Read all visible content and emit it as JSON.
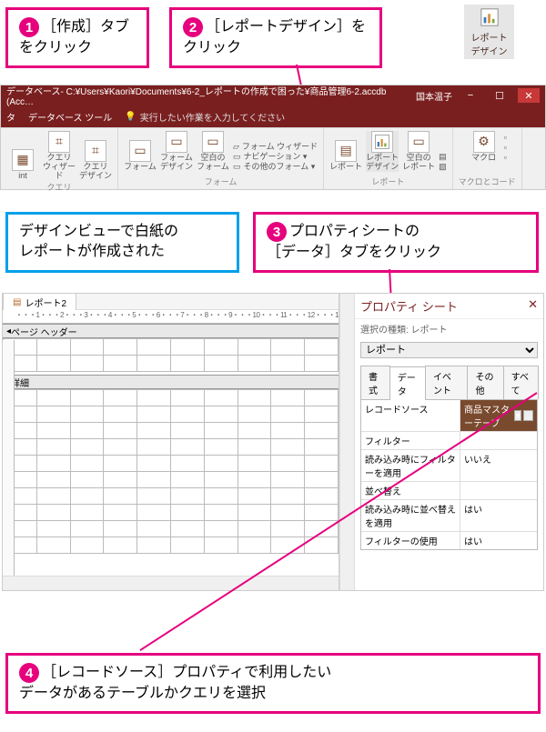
{
  "callouts": {
    "c1": {
      "num": "1",
      "text": "［作成］タブをクリック"
    },
    "c2": {
      "num": "2",
      "text": "［レポートデザイン］をクリック"
    },
    "cBlue": {
      "text1": "デザインビューで白紙の",
      "text2": "レポートが作成された"
    },
    "c3": {
      "num": "3",
      "text1": "プロパティシートの",
      "text2": "［データ］タブをクリック"
    },
    "c4": {
      "num": "4",
      "text1": "［レコードソース］プロパティで利用したい",
      "text2": "データがあるテーブルかクエリを選択"
    }
  },
  "report_icon_label": "レポート\nデザイン",
  "window": {
    "title": "データベース- C:¥Users¥Kaori¥Documents¥6-2_レポートの作成で困った¥商品管理6-2.accdb (Acc…",
    "user": "国本温子",
    "tabs": [
      "タ",
      "データベース ツール"
    ],
    "search_hint": "実行したい作業を入力してください"
  },
  "ribbon": {
    "groups": [
      {
        "label": "クエリ",
        "items": [
          {
            "label": "int"
          },
          {
            "label": "クエリ\nウィザード"
          },
          {
            "label": "クエリ\nデザイン"
          }
        ]
      },
      {
        "label": "フォーム",
        "items": [
          {
            "label": "フォーム"
          },
          {
            "label": "フォーム\nデザイン"
          },
          {
            "label": "空白の\nフォーム"
          }
        ],
        "side": [
          "フォーム ウィザード",
          "ナビゲーション ▾",
          "その他のフォーム ▾"
        ]
      },
      {
        "label": "レポート",
        "items": [
          {
            "label": "レポート"
          },
          {
            "label": "レポート\nデザイン"
          },
          {
            "label": "空白の\nレポート"
          }
        ],
        "side_icons": 2
      },
      {
        "label": "マクロとコード",
        "items": [
          {
            "label": "マクロ"
          }
        ]
      }
    ]
  },
  "design": {
    "tab": "レポート2",
    "ruler": "・・・1・・・2・・・3・・・4・・・5・・・6・・・7・・・8・・・9・・・10・・・11・・・12・・・13・・・14・・・15",
    "sections": [
      "ページ ヘッダー",
      "詳細"
    ]
  },
  "prop_sheet": {
    "title": "プロパティ シート",
    "subtitle": "選択の種類: レポート",
    "selector": "レポート",
    "tabs": [
      "書式",
      "データ",
      "イベント",
      "その他",
      "すべて"
    ],
    "rows": [
      {
        "k": "レコードソース",
        "v": "商品マスターテーブ",
        "hl": true
      },
      {
        "k": "フィルター",
        "v": ""
      },
      {
        "k": "読み込み時にフィルターを適用",
        "v": "いいえ"
      },
      {
        "k": "並べ替え",
        "v": ""
      },
      {
        "k": "読み込み時に並べ替えを適用",
        "v": "はい"
      },
      {
        "k": "フィルターの使用",
        "v": "はい"
      }
    ]
  }
}
